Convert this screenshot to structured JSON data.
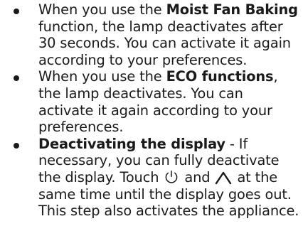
{
  "items": [
    {
      "pre": "When you use the ",
      "bold": "Moist Fan Baking",
      "post": " function, the lamp deactivates after 30 seconds. You can activate it again according to your preferences."
    },
    {
      "pre": "When you use the ",
      "bold": "ECO functions",
      "post": ", the lamp deactivates. You can activate it again according to your preferences."
    },
    {
      "bold": "Deactivating the display",
      "text_a": " - If necessary, you can fully deactivate the display. Touch ",
      "icon_a": "power-icon",
      "text_b": " and ",
      "icon_b": "chevron-up-icon",
      "text_c": " at the same time until the display goes out. This step also activates the appliance."
    }
  ]
}
